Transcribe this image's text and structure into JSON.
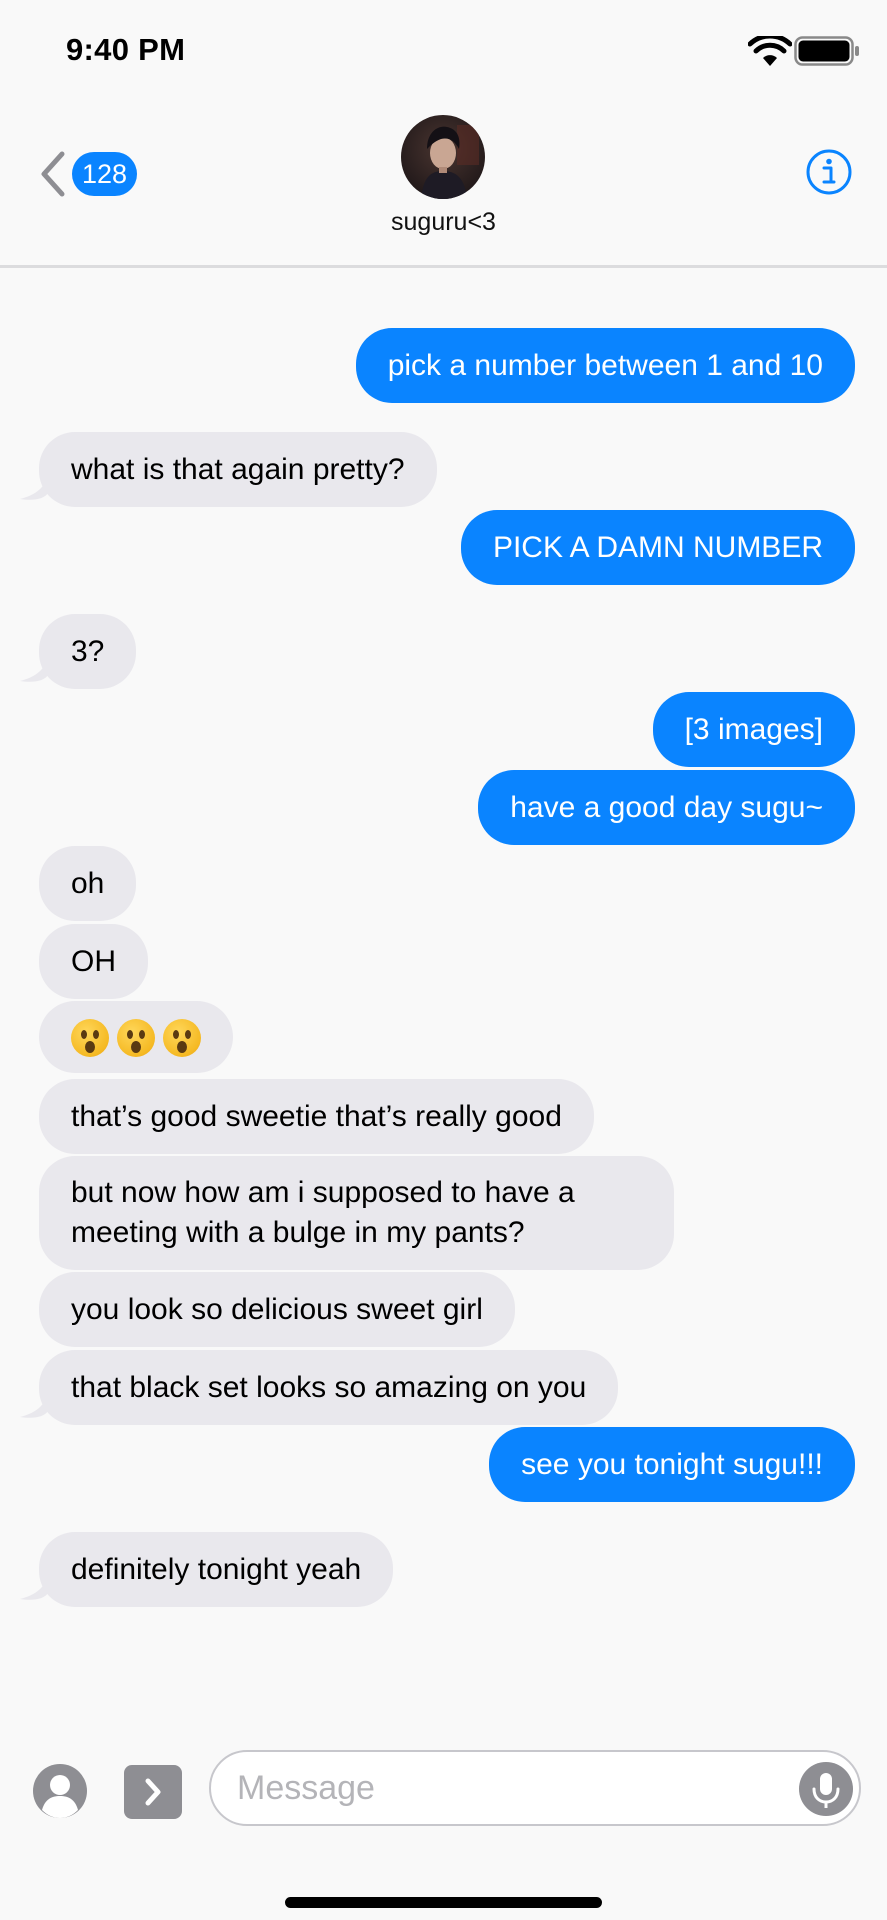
{
  "status_bar": {
    "time": "9:40 PM",
    "wifi_icon": "wifi-icon",
    "battery_icon": "battery-icon"
  },
  "header": {
    "back_icon": "chevron-left-icon",
    "unread_count": "128",
    "contact_name": "suguru<3",
    "info_icon": "info-icon"
  },
  "messages": [
    {
      "dir": "out",
      "text": "pick a number between 1 and 10"
    },
    {
      "dir": "in",
      "text": "what is that again pretty?"
    },
    {
      "dir": "out",
      "text": "PICK A DAMN NUMBER"
    },
    {
      "dir": "in",
      "text": "3?"
    },
    {
      "dir": "out",
      "text": "[3 images]"
    },
    {
      "dir": "out",
      "text": "have a good day sugu~"
    },
    {
      "dir": "in",
      "text": "oh"
    },
    {
      "dir": "in",
      "text": "OH"
    },
    {
      "dir": "in",
      "text": "😮😮😮",
      "emoji": "astonished-face"
    },
    {
      "dir": "in",
      "text": "that’s good sweetie that’s really good"
    },
    {
      "dir": "in",
      "text": "but now how am i supposed to have a meeting with a bulge in my pants?"
    },
    {
      "dir": "in",
      "text": "you look so delicious sweet girl"
    },
    {
      "dir": "in",
      "text": "that black set looks so amazing on you"
    },
    {
      "dir": "out",
      "text": "see you tonight sugu!!!"
    },
    {
      "dir": "in",
      "text": "definitely tonight yeah"
    }
  ],
  "composer": {
    "placeholder": "Message",
    "value": "",
    "contact_icon": "person-icon",
    "apps_icon": "chevron-right-icon",
    "mic_icon": "microphone-icon"
  },
  "colors": {
    "accent": "#0a84ff",
    "incoming_bubble": "#e9e8ed",
    "background": "#f9f9f9"
  }
}
